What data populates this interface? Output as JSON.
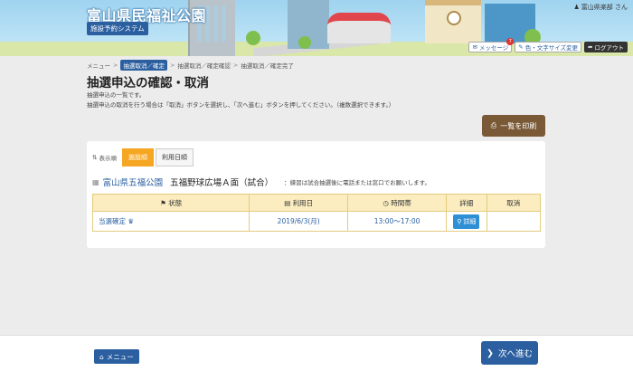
{
  "header": {
    "title": "富山県民福祉公園",
    "subtitle": "施設予約システム",
    "user": "富山県楽部 さん",
    "message_label": "メッセージ",
    "message_count": "7",
    "font_label": "色・文字サイズ変更",
    "logout_label": "ログアウト"
  },
  "breadcrumb": {
    "items": [
      "メニュー",
      "抽選取消／確定",
      "抽選取消／確定確認",
      "抽選取消／確定完了"
    ]
  },
  "page": {
    "title": "抽選申込の確認・取消",
    "desc1": "抽選申込の一覧です。",
    "desc2": "抽選申込の取消を行う場合は「取消」ボタンを選択し、「次へ進む」ボタンを押してください。（複数選択できます。）",
    "print_label": "一覧を印刷"
  },
  "sort": {
    "label": "表示順",
    "options": [
      "施設順",
      "利用日順"
    ]
  },
  "facility": {
    "name": "富山県五福公園",
    "room": "五福野球広場Ａ面（試合）",
    "note": "：練習は試合抽選後に電話または窓口でお願いします。"
  },
  "table": {
    "headers": [
      "状態",
      "利用日",
      "時間帯",
      "詳細",
      "取消"
    ],
    "rows": [
      {
        "status": "当選確定",
        "date": "2019/6/3(月)",
        "time": "13:00～17:00",
        "detail": "詳細",
        "cancel": ""
      }
    ]
  },
  "footer": {
    "menu_label": "メニュー",
    "next_label": "次へ進む"
  },
  "colors": {
    "primary": "#2b5fa0",
    "accent": "#f5a623",
    "print": "#7a5a36",
    "table_header": "#fbedc0"
  }
}
